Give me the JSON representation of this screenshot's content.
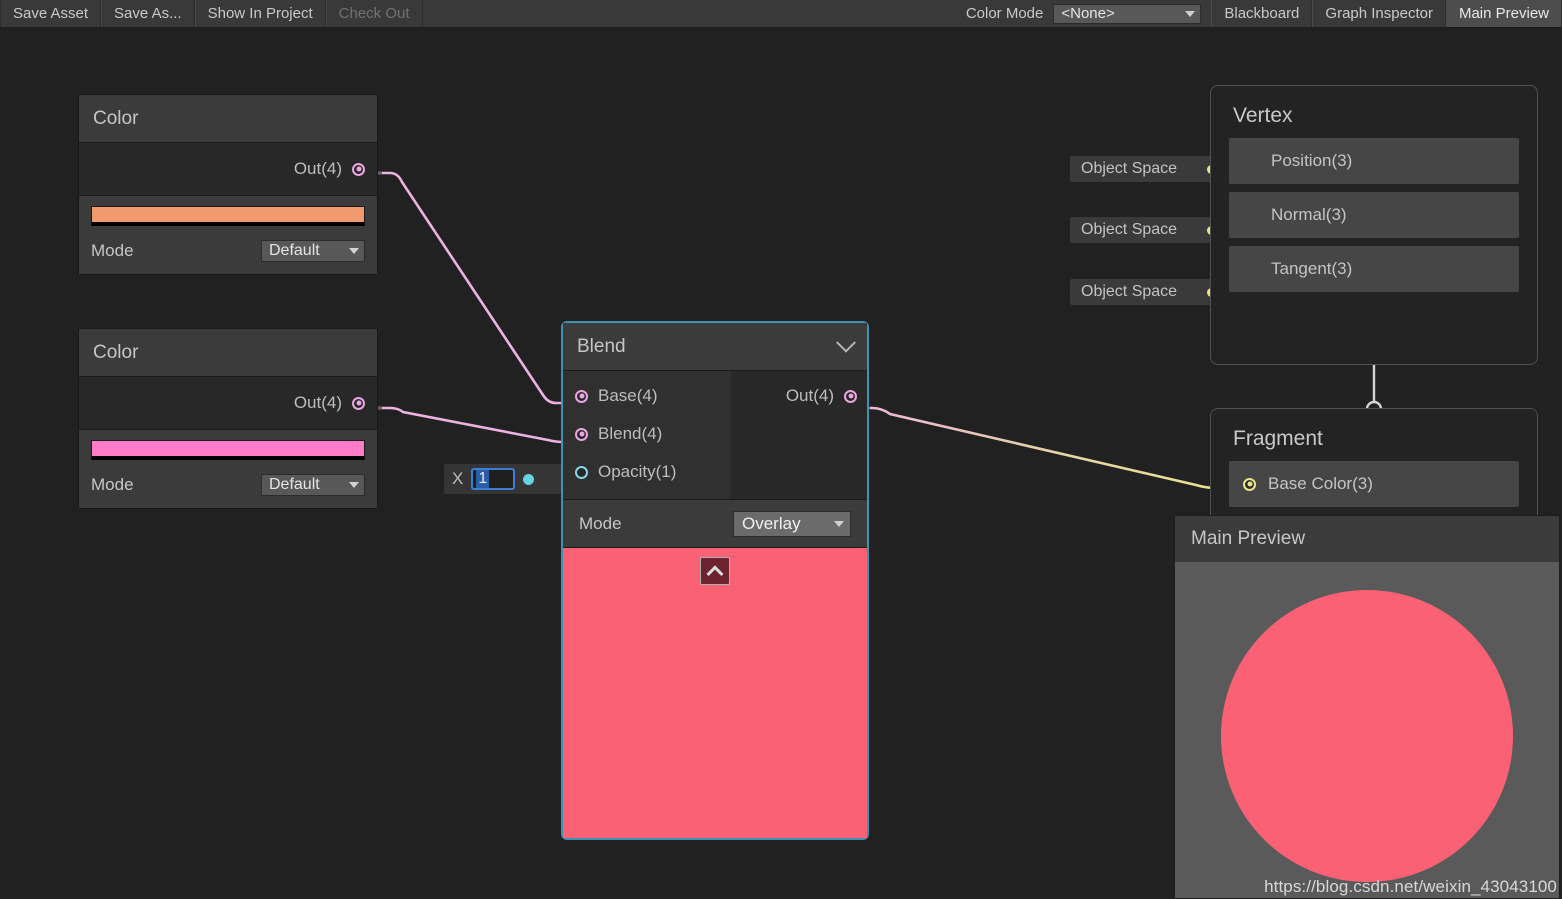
{
  "toolbar": {
    "buttons": [
      {
        "label": "Save Asset",
        "enabled": true
      },
      {
        "label": "Save As...",
        "enabled": true
      },
      {
        "label": "Show In Project",
        "enabled": true
      },
      {
        "label": "Check Out",
        "enabled": false
      }
    ],
    "color_mode_label": "Color Mode",
    "color_mode_value": "<None>",
    "panels": [
      {
        "label": "Blackboard",
        "active": false
      },
      {
        "label": "Graph Inspector",
        "active": false
      },
      {
        "label": "Main Preview",
        "active": true
      }
    ]
  },
  "nodes": {
    "color_a": {
      "title": "Color",
      "out_port": "Out(4)",
      "swatch_hex": "#f0996f",
      "mode_label": "Mode",
      "mode_value": "Default"
    },
    "color_b": {
      "title": "Color",
      "out_port": "Out(4)",
      "swatch_hex": "#ff7bc8",
      "mode_label": "Mode",
      "mode_value": "Default"
    },
    "blend": {
      "title": "Blend",
      "inputs": [
        {
          "label": "Base(4)",
          "type": "vector4"
        },
        {
          "label": "Blend(4)",
          "type": "vector4"
        },
        {
          "label": "Opacity(1)",
          "type": "float"
        }
      ],
      "output": "Out(4)",
      "mode_label": "Mode",
      "mode_value": "Overlay",
      "preview_hex": "#fb6175",
      "selected": true
    },
    "opacity_field": {
      "axis_label": "X",
      "value": "1"
    },
    "vertex": {
      "title": "Vertex",
      "slots": [
        {
          "label": "Position(3)",
          "space": "Object Space"
        },
        {
          "label": "Normal(3)",
          "space": "Object Space"
        },
        {
          "label": "Tangent(3)",
          "space": "Object Space"
        }
      ]
    },
    "fragment": {
      "title": "Fragment",
      "slots": [
        {
          "label": "Base Color(3)"
        }
      ]
    }
  },
  "main_preview": {
    "title": "Main Preview",
    "sphere_hex": "#fb6175",
    "watermark": "https://blog.csdn.net/weixin_43043100"
  },
  "colors": {
    "wire_pink": "#edb3e0",
    "wire_yellow": "#e8e58a",
    "wire_white": "#d5d5d5",
    "selection_cyan": "#3e92b5",
    "canvas_bg": "#212121"
  }
}
